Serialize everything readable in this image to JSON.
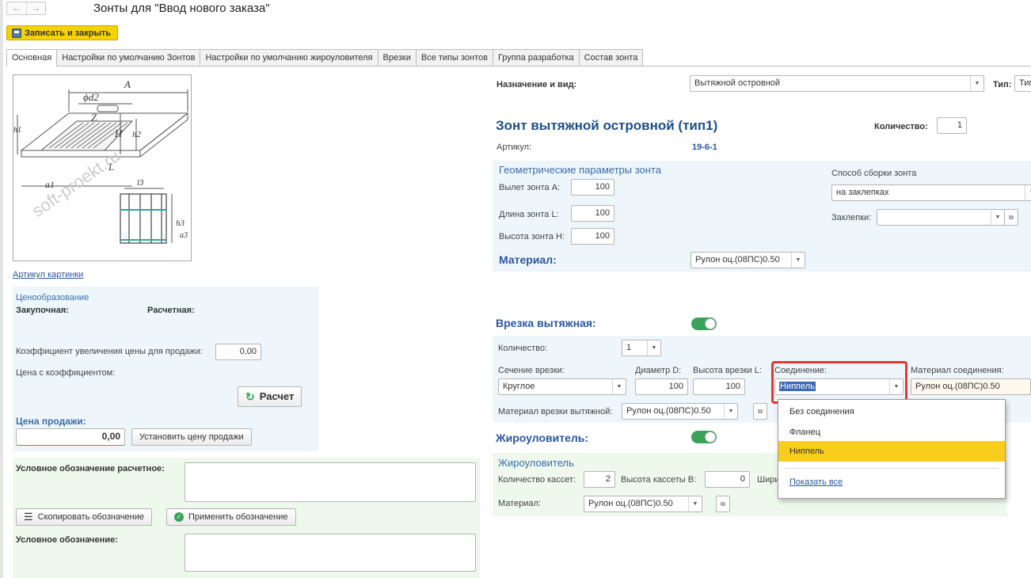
{
  "window": {
    "title": "Зонты для \"Ввод нового заказа\"",
    "back": "←",
    "forward": "→"
  },
  "toolbar": {
    "save_close": "Записать и закрыть"
  },
  "tabs": [
    {
      "label": "Основная"
    },
    {
      "label": "Настройки по умолчанию Зонтов"
    },
    {
      "label": "Настройки по умолчанию жироуловителя"
    },
    {
      "label": "Врезки"
    },
    {
      "label": "Все типы зонтов"
    },
    {
      "label": "Группа разработка"
    },
    {
      "label": "Состав зонта"
    }
  ],
  "image": {
    "link": "Артикул картинки",
    "letters": {
      "A": "A",
      "d2": "ϕd2",
      "Z": "Z",
      "H": "H",
      "h2": "h2",
      "h1": "h1",
      "L": "L",
      "a1": "a1",
      "l3": "l3",
      "h3": "h3",
      "a3": "a3"
    },
    "watermark": "soft-proekt.ru"
  },
  "pricing": {
    "title": "Ценообразование",
    "purchase_label": "Закупочная:",
    "calc_label": "Расчетная:",
    "coef_label": "Коэффициент увеличения цены для продажи:",
    "coef_value": "0,00",
    "coef_price_label": "Цена с коэффициентом:",
    "calc_button": "Расчет",
    "sale_label": "Цена продажи:",
    "sale_value": "0,00",
    "set_sale_button": "Установить цену продажи"
  },
  "designation": {
    "calc_label": "Условное обозначение расчетное:",
    "copy_button": "Скопировать обозначение",
    "apply_button": "Применить обозначение",
    "label": "Условное обозначение:"
  },
  "main": {
    "purpose_label": "Назначение и вид:",
    "purpose_value": "Вытяжной островной",
    "type_label": "Тип:",
    "type_value": "Тип",
    "hood_title": "Зонт вытяжной островной (тип1)",
    "qty_label": "Количество:",
    "qty_value": "1",
    "article_label": "Артикул:",
    "article_value": "19-6-1"
  },
  "geometry": {
    "title": "Геометрические параметры зонта",
    "a_label": "Вылет зонта А:",
    "a_value": "100",
    "l_label": "Длина зонта L:",
    "l_value": "100",
    "h_label": "Высота зонта H:",
    "h_value": "100",
    "assembly_label": "Способ сборки зонта",
    "assembly_value": "на заклепках",
    "rivets_label": "Заклепки:",
    "material_label": "Материал:",
    "material_value": "Рулон оц.(08ПС)0.50"
  },
  "insert": {
    "title": "Врезка вытяжная:",
    "qty_label": "Количество:",
    "qty_value": "1",
    "section_label": "Сечение врезки:",
    "section_value": "Круглое",
    "diam_label": "Диаметр D:",
    "diam_value": "100",
    "height_label": "Высота врезки L:",
    "height_value": "100",
    "conn_label": "Соединение:",
    "conn_value": "Ниппель",
    "conn_mat_label": "Материал соединения:",
    "conn_mat_value": "Рулон оц.(08ПС)0.50",
    "mat_label": "Материал врезки вытяжной:",
    "mat_value": "Рулон оц.(08ПС)0.50"
  },
  "grease": {
    "title": "Жироуловитель:",
    "subtitle": "Жироуловитель",
    "cassettes_label": "Количество кассет:",
    "cassettes_value": "2",
    "cass_height_label": "Высота кассеты В:",
    "cass_height_value": "0",
    "width_label": "Шири",
    "material_label": "Материал:",
    "material_value": "Рулон оц.(08ПС)0.50"
  },
  "dropdown": {
    "items": [
      {
        "label": "Без соединения"
      },
      {
        "label": "Фланец"
      },
      {
        "label": "Ниппель"
      }
    ],
    "show_all": "Показать все"
  },
  "colors": {
    "accent": "#f5d200",
    "highlight": "#f9cd1e",
    "link": "#2a56a0",
    "toggle": "#3aa35a",
    "focus_box": "#e03a30"
  }
}
